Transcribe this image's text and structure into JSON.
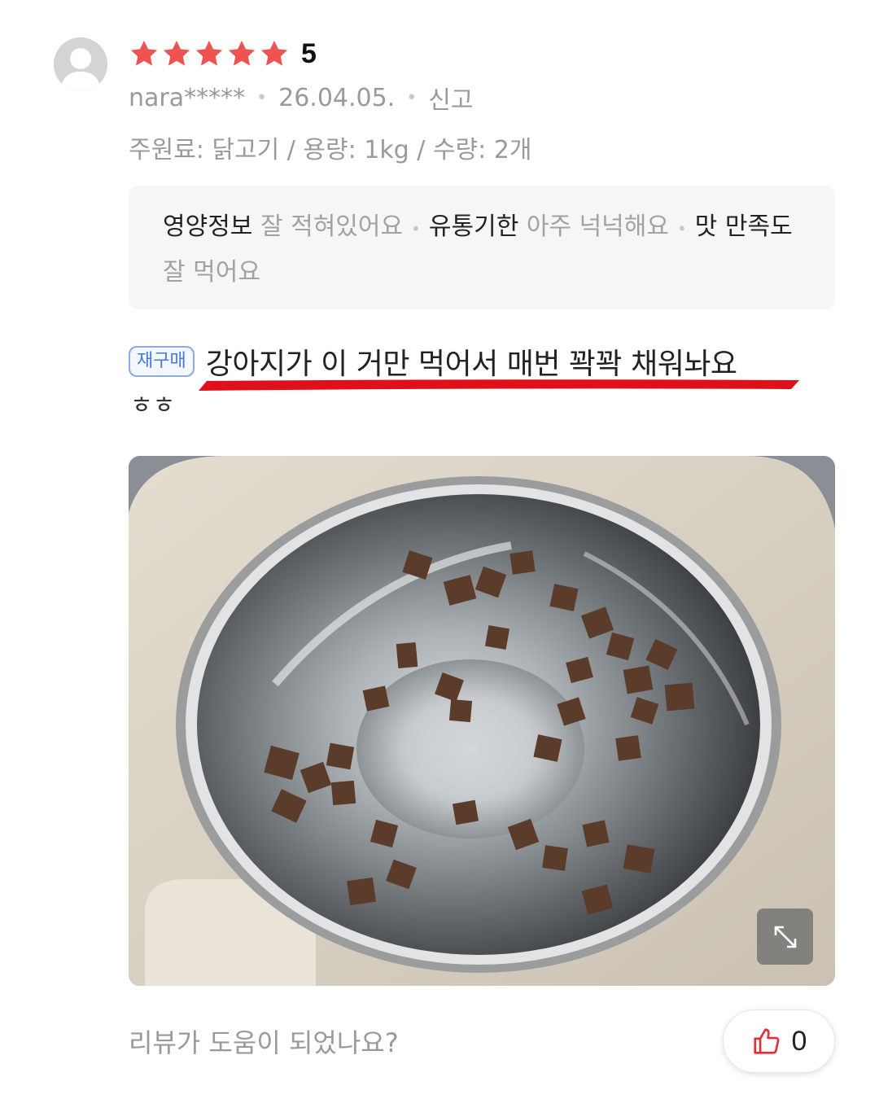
{
  "review": {
    "rating": 5,
    "score_label": "5",
    "username": "nara*****",
    "date": "26.04.05.",
    "report_label": "신고",
    "options": "주원료: 닭고기 / 용량: 1kg / 수량: 2개",
    "summary": [
      {
        "key": "영양정보",
        "value": "잘 적혀있어요"
      },
      {
        "key": "유통기한",
        "value": "아주 넉넉해요"
      },
      {
        "key": "맛 만족도",
        "value": "잘 먹어요"
      }
    ],
    "badge": "재구매",
    "headline": "강아지가 이 거만 먹어서 매번 꽉꽉 채워놔요",
    "body": "ㅎㅎ",
    "helpful_question": "리뷰가 도움이 되었나요?",
    "like_count": "0"
  },
  "icons": {
    "avatar": "default-user-avatar",
    "star": "star-icon",
    "expand": "expand-diagonal-icon",
    "like": "thumbs-up-icon"
  },
  "colors": {
    "star": "#ef5350",
    "underline": "#e0101a",
    "badge_border": "#8ea9e6",
    "badge_text": "#4a78d6",
    "like_icon": "#e0303a"
  }
}
